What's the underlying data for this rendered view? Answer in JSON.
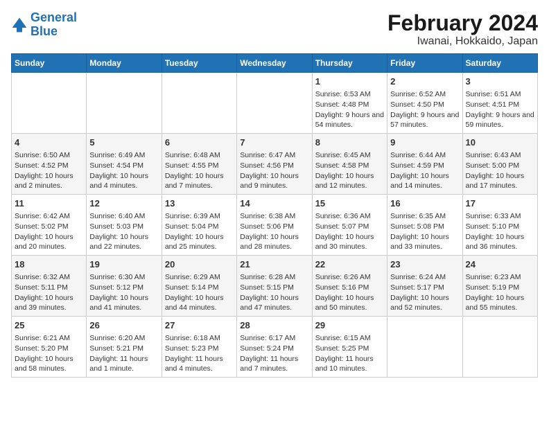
{
  "logo": {
    "line1": "General",
    "line2": "Blue"
  },
  "title": "February 2024",
  "subtitle": "Iwanai, Hokkaido, Japan",
  "headers": [
    "Sunday",
    "Monday",
    "Tuesday",
    "Wednesday",
    "Thursday",
    "Friday",
    "Saturday"
  ],
  "weeks": [
    [
      {
        "day": "",
        "sunrise": "",
        "sunset": "",
        "daylight": ""
      },
      {
        "day": "",
        "sunrise": "",
        "sunset": "",
        "daylight": ""
      },
      {
        "day": "",
        "sunrise": "",
        "sunset": "",
        "daylight": ""
      },
      {
        "day": "",
        "sunrise": "",
        "sunset": "",
        "daylight": ""
      },
      {
        "day": "1",
        "sunrise": "Sunrise: 6:53 AM",
        "sunset": "Sunset: 4:48 PM",
        "daylight": "Daylight: 9 hours and 54 minutes."
      },
      {
        "day": "2",
        "sunrise": "Sunrise: 6:52 AM",
        "sunset": "Sunset: 4:50 PM",
        "daylight": "Daylight: 9 hours and 57 minutes."
      },
      {
        "day": "3",
        "sunrise": "Sunrise: 6:51 AM",
        "sunset": "Sunset: 4:51 PM",
        "daylight": "Daylight: 9 hours and 59 minutes."
      }
    ],
    [
      {
        "day": "4",
        "sunrise": "Sunrise: 6:50 AM",
        "sunset": "Sunset: 4:52 PM",
        "daylight": "Daylight: 10 hours and 2 minutes."
      },
      {
        "day": "5",
        "sunrise": "Sunrise: 6:49 AM",
        "sunset": "Sunset: 4:54 PM",
        "daylight": "Daylight: 10 hours and 4 minutes."
      },
      {
        "day": "6",
        "sunrise": "Sunrise: 6:48 AM",
        "sunset": "Sunset: 4:55 PM",
        "daylight": "Daylight: 10 hours and 7 minutes."
      },
      {
        "day": "7",
        "sunrise": "Sunrise: 6:47 AM",
        "sunset": "Sunset: 4:56 PM",
        "daylight": "Daylight: 10 hours and 9 minutes."
      },
      {
        "day": "8",
        "sunrise": "Sunrise: 6:45 AM",
        "sunset": "Sunset: 4:58 PM",
        "daylight": "Daylight: 10 hours and 12 minutes."
      },
      {
        "day": "9",
        "sunrise": "Sunrise: 6:44 AM",
        "sunset": "Sunset: 4:59 PM",
        "daylight": "Daylight: 10 hours and 14 minutes."
      },
      {
        "day": "10",
        "sunrise": "Sunrise: 6:43 AM",
        "sunset": "Sunset: 5:00 PM",
        "daylight": "Daylight: 10 hours and 17 minutes."
      }
    ],
    [
      {
        "day": "11",
        "sunrise": "Sunrise: 6:42 AM",
        "sunset": "Sunset: 5:02 PM",
        "daylight": "Daylight: 10 hours and 20 minutes."
      },
      {
        "day": "12",
        "sunrise": "Sunrise: 6:40 AM",
        "sunset": "Sunset: 5:03 PM",
        "daylight": "Daylight: 10 hours and 22 minutes."
      },
      {
        "day": "13",
        "sunrise": "Sunrise: 6:39 AM",
        "sunset": "Sunset: 5:04 PM",
        "daylight": "Daylight: 10 hours and 25 minutes."
      },
      {
        "day": "14",
        "sunrise": "Sunrise: 6:38 AM",
        "sunset": "Sunset: 5:06 PM",
        "daylight": "Daylight: 10 hours and 28 minutes."
      },
      {
        "day": "15",
        "sunrise": "Sunrise: 6:36 AM",
        "sunset": "Sunset: 5:07 PM",
        "daylight": "Daylight: 10 hours and 30 minutes."
      },
      {
        "day": "16",
        "sunrise": "Sunrise: 6:35 AM",
        "sunset": "Sunset: 5:08 PM",
        "daylight": "Daylight: 10 hours and 33 minutes."
      },
      {
        "day": "17",
        "sunrise": "Sunrise: 6:33 AM",
        "sunset": "Sunset: 5:10 PM",
        "daylight": "Daylight: 10 hours and 36 minutes."
      }
    ],
    [
      {
        "day": "18",
        "sunrise": "Sunrise: 6:32 AM",
        "sunset": "Sunset: 5:11 PM",
        "daylight": "Daylight: 10 hours and 39 minutes."
      },
      {
        "day": "19",
        "sunrise": "Sunrise: 6:30 AM",
        "sunset": "Sunset: 5:12 PM",
        "daylight": "Daylight: 10 hours and 41 minutes."
      },
      {
        "day": "20",
        "sunrise": "Sunrise: 6:29 AM",
        "sunset": "Sunset: 5:14 PM",
        "daylight": "Daylight: 10 hours and 44 minutes."
      },
      {
        "day": "21",
        "sunrise": "Sunrise: 6:28 AM",
        "sunset": "Sunset: 5:15 PM",
        "daylight": "Daylight: 10 hours and 47 minutes."
      },
      {
        "day": "22",
        "sunrise": "Sunrise: 6:26 AM",
        "sunset": "Sunset: 5:16 PM",
        "daylight": "Daylight: 10 hours and 50 minutes."
      },
      {
        "day": "23",
        "sunrise": "Sunrise: 6:24 AM",
        "sunset": "Sunset: 5:17 PM",
        "daylight": "Daylight: 10 hours and 52 minutes."
      },
      {
        "day": "24",
        "sunrise": "Sunrise: 6:23 AM",
        "sunset": "Sunset: 5:19 PM",
        "daylight": "Daylight: 10 hours and 55 minutes."
      }
    ],
    [
      {
        "day": "25",
        "sunrise": "Sunrise: 6:21 AM",
        "sunset": "Sunset: 5:20 PM",
        "daylight": "Daylight: 10 hours and 58 minutes."
      },
      {
        "day": "26",
        "sunrise": "Sunrise: 6:20 AM",
        "sunset": "Sunset: 5:21 PM",
        "daylight": "Daylight: 11 hours and 1 minute."
      },
      {
        "day": "27",
        "sunrise": "Sunrise: 6:18 AM",
        "sunset": "Sunset: 5:23 PM",
        "daylight": "Daylight: 11 hours and 4 minutes."
      },
      {
        "day": "28",
        "sunrise": "Sunrise: 6:17 AM",
        "sunset": "Sunset: 5:24 PM",
        "daylight": "Daylight: 11 hours and 7 minutes."
      },
      {
        "day": "29",
        "sunrise": "Sunrise: 6:15 AM",
        "sunset": "Sunset: 5:25 PM",
        "daylight": "Daylight: 11 hours and 10 minutes."
      },
      {
        "day": "",
        "sunrise": "",
        "sunset": "",
        "daylight": ""
      },
      {
        "day": "",
        "sunrise": "",
        "sunset": "",
        "daylight": ""
      }
    ]
  ]
}
